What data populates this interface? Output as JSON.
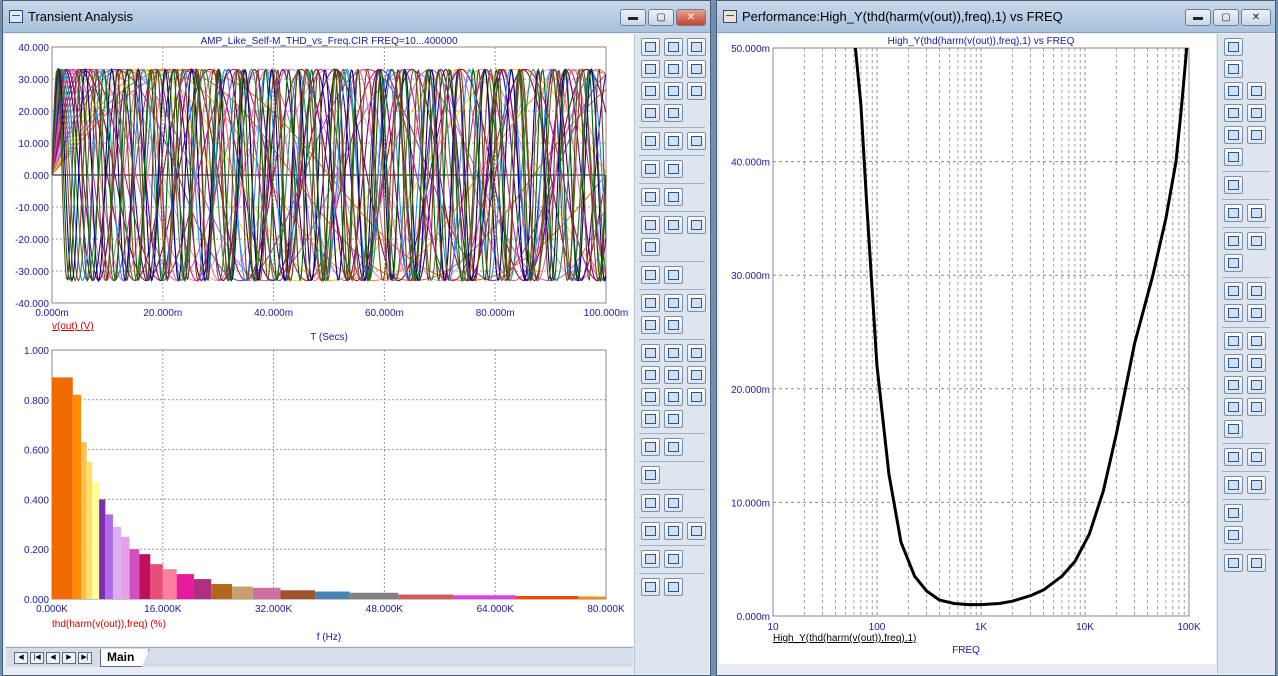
{
  "left_window": {
    "title": "Transient Analysis",
    "min_label": "▬",
    "max_label": "▢",
    "close_label": "✕",
    "tab_main": "Main",
    "nav": [
      "◀",
      "|◀",
      "◀",
      "▶",
      "▶|"
    ]
  },
  "right_window": {
    "title": "Performance:High_Y(thd(harm(v(out)),freq),1) vs FREQ",
    "min_label": "▬",
    "max_label": "▢",
    "close_label": "✕"
  },
  "chart_data": [
    {
      "type": "line",
      "title": "AMP_Like_Self-M_THD_vs_Freq.CIR FREQ=10...400000",
      "xlabel": "T (Secs)",
      "ylabel": "v(out) (V)",
      "x_ticks": [
        "0.000m",
        "20.000m",
        "40.000m",
        "60.000m",
        "80.000m",
        "100.000m"
      ],
      "y_ticks": [
        "40.000",
        "30.000",
        "20.000",
        "10.000",
        "0.000",
        "-10.000",
        "-20.000",
        "-30.000",
        "-40.000"
      ],
      "xlim": [
        0,
        100
      ],
      "ylim": [
        -40,
        40
      ],
      "amplitude": 33,
      "series_note": "family of sine waves, one per FREQ step",
      "frequencies_hz": [
        10,
        11.5,
        13,
        15,
        17,
        19.5,
        22,
        25,
        29,
        33,
        38,
        44,
        50,
        58,
        67,
        77,
        89,
        102,
        118,
        136,
        157,
        180,
        208,
        240,
        276
      ],
      "colors": [
        "#e07b00",
        "#c07a20",
        "#ff9900",
        "#ffcc00",
        "#e8e800",
        "#b06de0",
        "#8e44ad",
        "#d4a6e6",
        "#ee82ee",
        "#cc66cc",
        "#c71585",
        "#8b0a50",
        "#a01050",
        "#ff69b4",
        "#d02090",
        "#e066a3",
        "#800080",
        "#4b0082",
        "#2e8b57",
        "#1e90ff",
        "#556b2f",
        "#8b4513",
        "#000080",
        "#006400",
        "#654321"
      ]
    },
    {
      "type": "bar",
      "xlabel": "f (Hz)",
      "ylabel": "thd(harm(v(out)),freq) (%)",
      "x_ticks": [
        "0.000K",
        "16.000K",
        "32.000K",
        "48.000K",
        "64.000K",
        "80.000K"
      ],
      "y_ticks": [
        "1.000",
        "0.800",
        "0.600",
        "0.400",
        "0.200",
        "0.000"
      ],
      "xlim": [
        0,
        80000
      ],
      "ylim": [
        0,
        1
      ],
      "bars": [
        {
          "x0": 0,
          "x1": 3000,
          "value": 0.89,
          "color": "#f06a00"
        },
        {
          "x0": 3000,
          "x1": 4200,
          "value": 0.82,
          "color": "#ff8c00"
        },
        {
          "x0": 4200,
          "x1": 5000,
          "value": 0.63,
          "color": "#ffc04d"
        },
        {
          "x0": 5000,
          "x1": 5800,
          "value": 0.55,
          "color": "#ffe066"
        },
        {
          "x0": 5800,
          "x1": 6800,
          "value": 0.47,
          "color": "#ffff99"
        },
        {
          "x0": 6800,
          "x1": 7700,
          "value": 0.4,
          "color": "#7b2fb5"
        },
        {
          "x0": 7700,
          "x1": 8800,
          "value": 0.34,
          "color": "#b368e8"
        },
        {
          "x0": 8800,
          "x1": 10000,
          "value": 0.29,
          "color": "#d9b0f0"
        },
        {
          "x0": 10000,
          "x1": 11200,
          "value": 0.25,
          "color": "#e6a0e6"
        },
        {
          "x0": 11200,
          "x1": 12600,
          "value": 0.2,
          "color": "#d050c0"
        },
        {
          "x0": 12600,
          "x1": 14200,
          "value": 0.18,
          "color": "#c0105a"
        },
        {
          "x0": 14200,
          "x1": 16000,
          "value": 0.14,
          "color": "#e64d7a"
        },
        {
          "x0": 16000,
          "x1": 18000,
          "value": 0.12,
          "color": "#ff7f9e"
        },
        {
          "x0": 18000,
          "x1": 20500,
          "value": 0.1,
          "color": "#e61a9e"
        },
        {
          "x0": 20500,
          "x1": 23000,
          "value": 0.08,
          "color": "#b03080"
        },
        {
          "x0": 23000,
          "x1": 26000,
          "value": 0.06,
          "color": "#b5651d"
        },
        {
          "x0": 26000,
          "x1": 29000,
          "value": 0.05,
          "color": "#c8a070"
        },
        {
          "x0": 29000,
          "x1": 33000,
          "value": 0.045,
          "color": "#d070a0"
        },
        {
          "x0": 33000,
          "x1": 38000,
          "value": 0.035,
          "color": "#a0522d"
        },
        {
          "x0": 38000,
          "x1": 43000,
          "value": 0.03,
          "color": "#4682b4"
        },
        {
          "x0": 43000,
          "x1": 50000,
          "value": 0.025,
          "color": "#808080"
        },
        {
          "x0": 50000,
          "x1": 58000,
          "value": 0.018,
          "color": "#cd5c5c"
        },
        {
          "x0": 58000,
          "x1": 67000,
          "value": 0.015,
          "color": "#e040e0"
        },
        {
          "x0": 67000,
          "x1": 76000,
          "value": 0.012,
          "color": "#ff4500"
        },
        {
          "x0": 76000,
          "x1": 80000,
          "value": 0.01,
          "color": "#ff8c00"
        }
      ]
    },
    {
      "type": "line",
      "title": "High_Y(thd(harm(v(out)),freq),1) vs FREQ",
      "xlabel": "FREQ",
      "ylabel": "High_Y(thd(harm(v(out)),freq),1)",
      "x_scale": "log",
      "x_ticks": [
        "10",
        "100",
        "1K",
        "10K",
        "100K"
      ],
      "y_ticks": [
        "50.000m",
        "40.000m",
        "30.000m",
        "20.000m",
        "10.000m",
        "0.000m"
      ],
      "xlim": [
        10,
        100000
      ],
      "ylim": [
        0,
        0.05
      ],
      "x": [
        62,
        70,
        80,
        100,
        130,
        170,
        230,
        300,
        400,
        550,
        750,
        1000,
        1500,
        2000,
        3000,
        4000,
        6000,
        8000,
        11000,
        15000,
        20000,
        30000,
        45000,
        60000,
        75000,
        85000,
        95000
      ],
      "y": [
        0.05,
        0.045,
        0.036,
        0.022,
        0.0125,
        0.0065,
        0.0035,
        0.0022,
        0.0014,
        0.0011,
        0.001,
        0.001,
        0.0011,
        0.0013,
        0.0018,
        0.0023,
        0.0035,
        0.0048,
        0.0072,
        0.011,
        0.016,
        0.024,
        0.03,
        0.035,
        0.04,
        0.045,
        0.05
      ]
    }
  ]
}
